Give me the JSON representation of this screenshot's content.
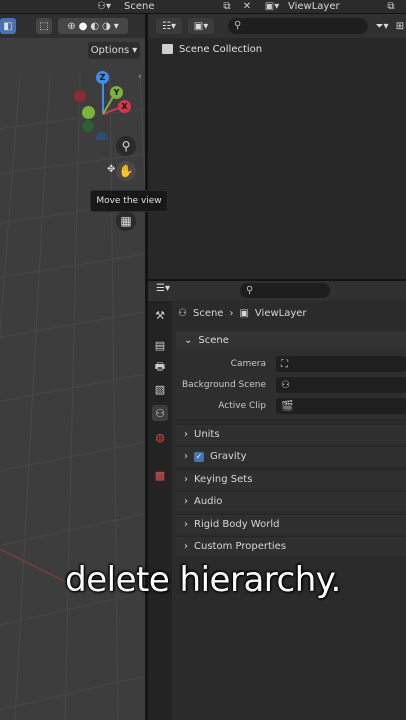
{
  "topbar": {
    "scene_label": "Scene",
    "viewlayer_label": "ViewLayer"
  },
  "viewport": {
    "options_label": "Options",
    "gizmo": {
      "z": "Z",
      "y": "Y",
      "x": "X"
    },
    "tooltip": "Move the view"
  },
  "outliner": {
    "search_icon": "search-icon",
    "root_label": "Scene Collection"
  },
  "properties": {
    "breadcrumb": [
      "Scene",
      "ViewLayer"
    ],
    "panel_title": "Scene",
    "fields": [
      {
        "label": "Camera",
        "value": ""
      },
      {
        "label": "Background Scene",
        "value": ""
      },
      {
        "label": "Active Clip",
        "value": ""
      }
    ],
    "subpanels": [
      "Units",
      "Gravity",
      "Keying Sets",
      "Audio",
      "Rigid Body World",
      "Custom Properties"
    ],
    "gravity_checked": true
  },
  "caption": "delete hierarchy.",
  "colors": {
    "x_axis": "#d2384a",
    "y_axis": "#7ab53b",
    "z_axis": "#3e8ee8",
    "accent": "#4772b3"
  }
}
